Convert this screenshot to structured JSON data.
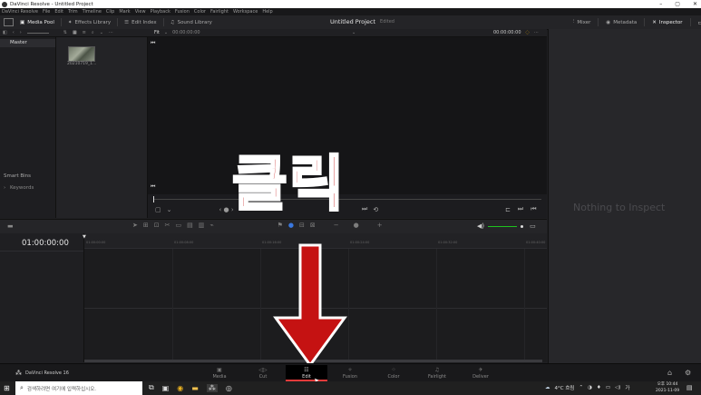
{
  "window": {
    "title": "DaVinci Resolve - Untitled Project",
    "controls": [
      "–",
      "▢",
      "✕"
    ]
  },
  "menu": [
    "DaVinci Resolve",
    "File",
    "Edit",
    "Trim",
    "Timeline",
    "Clip",
    "Mark",
    "View",
    "Playback",
    "Fusion",
    "Color",
    "Fairlight",
    "Workspace",
    "Help"
  ],
  "toolbar": {
    "left": [
      {
        "label": "Media Pool",
        "icon": "media-pool-icon"
      },
      {
        "label": "Effects Library",
        "icon": "effects-icon"
      },
      {
        "label": "Edit Index",
        "icon": "edit-index-icon"
      },
      {
        "label": "Sound Library",
        "icon": "sound-library-icon"
      }
    ],
    "project_title": "Untitled Project",
    "project_status": "Edited",
    "right": [
      {
        "label": "Mixer",
        "icon": "mixer-icon"
      },
      {
        "label": "Metadata",
        "icon": "metadata-icon"
      },
      {
        "label": "Inspector",
        "icon": "inspector-icon"
      }
    ]
  },
  "viewer_bar": {
    "zoom": "Fit",
    "source_timecode": "00:00:00:00",
    "right_timecode": "00:00:00:00"
  },
  "bins": {
    "master": "Master",
    "smart_bins": "Smart Bins",
    "keywords": "Keywords"
  },
  "clip": {
    "name": "20210719_1..."
  },
  "inspector": {
    "empty_text": "Nothing to Inspect"
  },
  "timeline": {
    "timecode": "01:00:00:00",
    "ruler": [
      "01:00:00:00",
      "01:00:08:00",
      "01:00:16:00",
      "01:00:24:00",
      "01:00:32:00",
      "01:00:40:00"
    ]
  },
  "overlay": {
    "text": "클릭",
    "color": "#c51212"
  },
  "pages": {
    "app_name": "DaVinci Resolve 16",
    "items": [
      {
        "label": "Media",
        "icon": "media-page-icon"
      },
      {
        "label": "Cut",
        "icon": "cut-page-icon"
      },
      {
        "label": "Edit",
        "icon": "edit-page-icon",
        "active": true
      },
      {
        "label": "Fusion",
        "icon": "fusion-page-icon"
      },
      {
        "label": "Color",
        "icon": "color-page-icon"
      },
      {
        "label": "Fairlight",
        "icon": "fairlight-page-icon"
      },
      {
        "label": "Deliver",
        "icon": "deliver-page-icon"
      }
    ]
  },
  "taskbar": {
    "search_placeholder": "검색하려면 여기에 입력하십시오.",
    "weather": "4°C 흐림",
    "time": "오후 10:44",
    "date": "2021-11-09"
  }
}
